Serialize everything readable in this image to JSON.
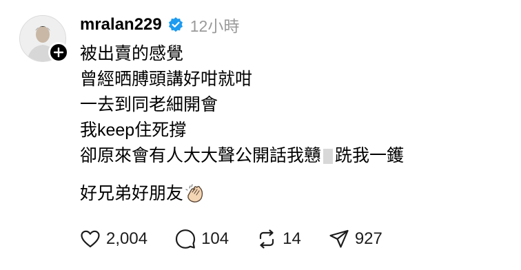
{
  "post": {
    "username": "mralan229",
    "time": "12小時",
    "lines": [
      "被出賣的感覺",
      "曾經晒膊頭講好咁就咁",
      "一去到同老細開會",
      "我keep住死撐"
    ],
    "line5_before": "卻原來會有人大大聲公開話我戇",
    "line5_after": "跣我一鑊",
    "last_line": "好兄弟好朋友"
  },
  "actions": {
    "likes": "2,004",
    "comments": "104",
    "reposts": "14",
    "shares": "927"
  },
  "icons": {
    "verified": "verified-badge-icon",
    "follow": "plus-icon",
    "emoji": "clapping-hands-icon",
    "like": "heart-icon",
    "comment": "speech-bubble-icon",
    "repost": "repost-arrows-icon",
    "share": "paper-plane-icon"
  },
  "colors": {
    "verified": "#1d9bf0",
    "muted": "#9a9a9a"
  }
}
